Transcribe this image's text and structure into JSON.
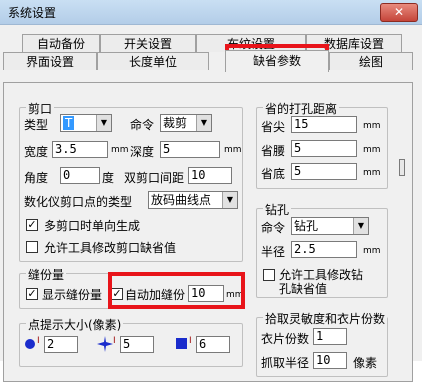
{
  "window": {
    "title": "系统设置",
    "close_label": "✕"
  },
  "tabs": {
    "row1": [
      "自动备份",
      "开关设置",
      "布纹设置",
      "数据库设置"
    ],
    "row2": [
      "界面设置",
      "长度单位",
      "缺省参数",
      "绘图"
    ],
    "active": "缺省参数"
  },
  "cut": {
    "legend": "剪口",
    "type_label": "类型",
    "type_value": "T",
    "cmd_label": "命令",
    "cmd_value": "裁剪",
    "width_label": "宽度",
    "width_value": "3.5",
    "depth_label": "深度",
    "depth_value": "5",
    "unit": "mm",
    "angle_label": "角度",
    "angle_value": "0",
    "angle_unit": "度",
    "gap_label": "双剪口间距",
    "gap_value": "10",
    "digitizer_label": "数化仪剪口点的类型",
    "digitizer_value": "放码曲线点",
    "opt1": "多剪口时单向生成",
    "opt1_checked": true,
    "opt2": "允许工具修改剪口缺省值",
    "opt2_checked": false
  },
  "seam": {
    "legend": "缝份量",
    "show_label": "显示缝份量",
    "show_checked": true,
    "auto_label": "自动加缝份",
    "auto_checked": true,
    "value": "10",
    "unit": "mm"
  },
  "point_size": {
    "legend": "点提示大小(像素)",
    "v1": "2",
    "v2": "5",
    "v3": "6"
  },
  "punch_distance": {
    "legend": "省的打孔距离",
    "tip_label": "省尖",
    "tip_value": "15",
    "waist_label": "省腰",
    "waist_value": "5",
    "bottom_label": "省底",
    "bottom_value": "5",
    "unit": "mm"
  },
  "drill": {
    "legend": "钻孔",
    "cmd_label": "命令",
    "cmd_value": "钻孔",
    "radius_label": "半径",
    "radius_value": "2.5",
    "unit": "mm",
    "allow_label_1": "允许工具修改钻",
    "allow_label_2": "孔缺省值",
    "allow_checked": false
  },
  "pickup": {
    "legend": "拾取灵敏度和衣片份数",
    "pieces_label": "衣片份数",
    "pieces_value": "1",
    "radius_label": "抓取半径",
    "radius_value": "10",
    "radius_unit": "像素"
  },
  "colors": {
    "highlight": "#e8141a",
    "selection": "#3399ff"
  }
}
